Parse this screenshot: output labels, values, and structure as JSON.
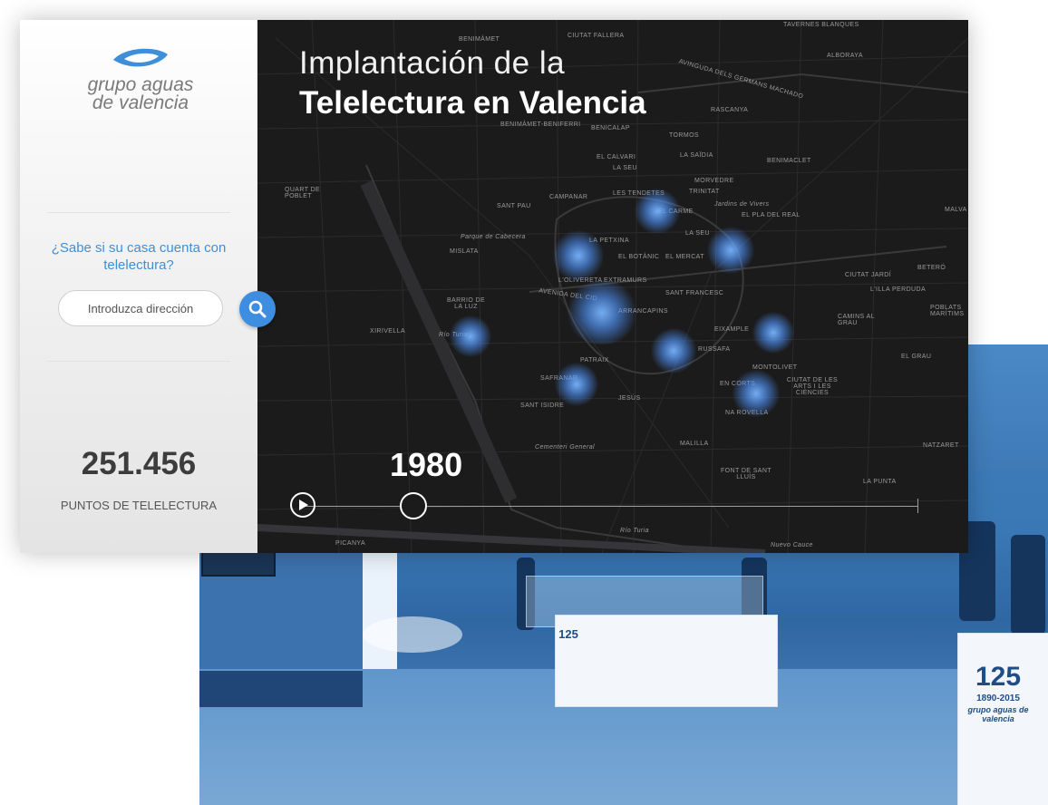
{
  "app": {
    "logo": {
      "line1": "grupo aguas",
      "line2": "de valencia"
    },
    "question": "¿Sabe si su casa cuenta con telelectura?",
    "search": {
      "placeholder": "Introduzca dirección",
      "value": ""
    },
    "stats": {
      "count": "251.456",
      "label": "PUNTOS DE TELELECTURA"
    }
  },
  "map": {
    "title_line1": "Implantación de la",
    "title_line2": "Telelectura en Valencia",
    "year": "1980",
    "timeline_progress": 0.18,
    "labels": {
      "patraix": "PATRAIX",
      "benimamet": "BENIMÀMET",
      "campanar_top": "CAMPANAR",
      "tavernes": "TAVERNES BLANQUES",
      "ciutat_fallera": "CIUTAT FALLERA",
      "alboraya": "ALBORAYA",
      "germans_machado": "AVINGUDA DELS GERMANS MACHADO",
      "rascanya": "RASCANYA",
      "benimamet_beniferri": "BENIMÀMET-BENIFERRI",
      "benicalap": "BENICALAP",
      "tormos": "TORMOS",
      "el_calvari": "EL CALVARI",
      "la_saidia": "LA SAÏDIA",
      "la_seu_top": "LA SEU",
      "benimaclet": "BENIMACLET",
      "quart": "QUART DE POBLET",
      "campanar": "CAMPANAR",
      "les_tendetes": "LES TENDETES",
      "morvedre": "MORVEDRE",
      "trinitat": "TRINITAT",
      "sant_pau": "SANT PAU",
      "el_carme": "EL CARME",
      "vivers": "Jardins de Vivers",
      "pla_real": "EL PLA DEL REAL",
      "malva": "MALVA",
      "cabecera": "Parque de Cabecera",
      "la_petxina": "LA PETXINA",
      "la_seu": "LA SEU",
      "mislata": "MISLATA",
      "el_botanic": "EL BOTÀNIC",
      "el_mercat": "EL MERCAT",
      "ciutat_jardi": "CIUTAT JARDÍ",
      "betero": "BETERÓ",
      "olivereta": "L'OLIVERETA",
      "extramurs": "EXTRAMURS",
      "avinguda_cid": "AVENIDA DEL CID",
      "sant_francesc": "SANT FRANCESC",
      "lilla": "L'ILLA PERDUDA",
      "barrio_luz": "BARRIO DE LA LUZ",
      "arrancapins": "ARRANCAPINS",
      "camins": "CAMINS AL GRAU",
      "poblats": "POBLATS MARÍTIMS",
      "xirivella": "XIRIVELLA",
      "rio_turia_w": "Río Turia",
      "eixample": "EIXAMPLE",
      "russafa": "RUSSAFA",
      "el_grau": "EL GRAU",
      "patraix2": "PATRAIX",
      "montolivet": "MONTOLIVET",
      "safranar": "SAFRANAR",
      "en_corts": "EN CORTS",
      "ciutat_arts": "CIUTAT DE LES ARTS I LES CIÈNCIES",
      "jesus": "JESÚS",
      "sant_isidre": "SANT ISIDRE",
      "na_rovella": "NA ROVELLA",
      "natzaret": "NATZARET",
      "malilla": "MALILLA",
      "cementeri": "Cementeri General",
      "font_santa": "FONT DE SANT LLUÍS",
      "la_punta": "LA PUNTA",
      "picanya": "PICANYA",
      "rio_turia_s": "Río Turia",
      "nuevo_cauce": "Nuevo Cauce"
    }
  },
  "photo": {
    "badge_number": "125",
    "badge_years": "1890-2015",
    "badge_brand": "grupo aguas de valencia"
  },
  "colors": {
    "accent": "#3d8ee0",
    "map_bg": "#1b1b1c",
    "glow": "#5aa0ff",
    "photo_tint": "#3a78b5"
  }
}
